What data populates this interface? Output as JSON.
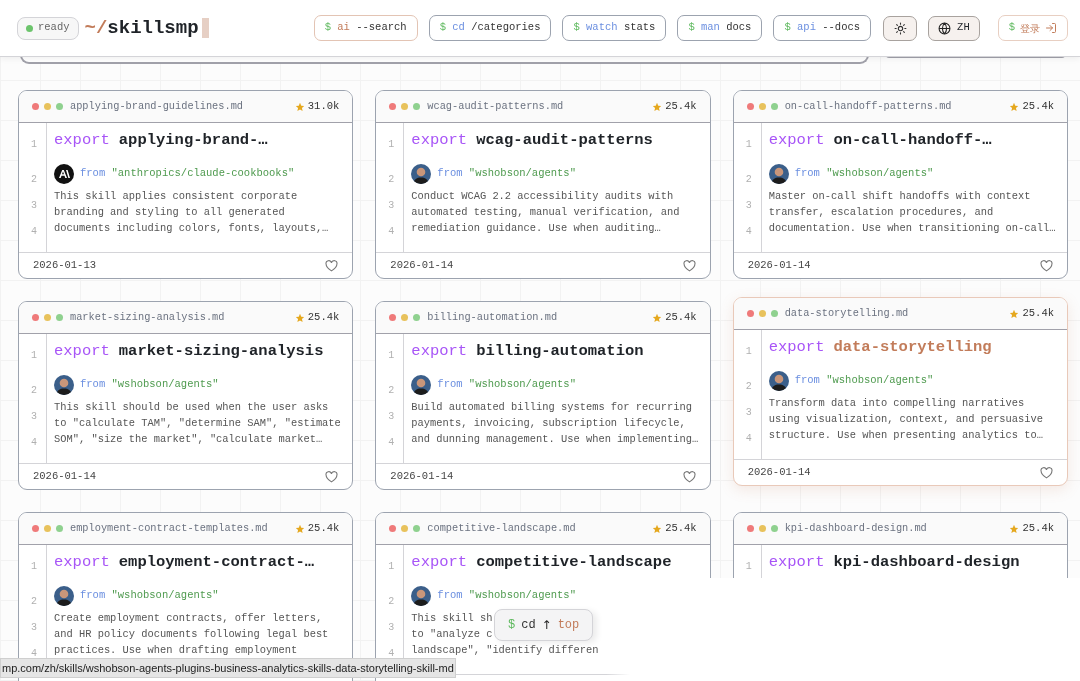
{
  "header": {
    "status": {
      "label": "ready",
      "online": true
    },
    "logo": {
      "prefix": "~/",
      "name": "skillsmp"
    },
    "nav": [
      {
        "prompt": "$",
        "command": "ai",
        "arg": "--search",
        "kind": "accent"
      },
      {
        "prompt": "$",
        "command": "cd",
        "arg": "/categories",
        "kind": "plain"
      },
      {
        "prompt": "$",
        "command": "watch",
        "arg": "stats",
        "kind": "plain"
      },
      {
        "prompt": "$",
        "command": "man",
        "arg": "docs",
        "kind": "plain"
      },
      {
        "prompt": "$",
        "command": "api",
        "arg": "--docs",
        "kind": "plain"
      }
    ],
    "language": "ZH",
    "login": {
      "prompt": "$",
      "label": "登录"
    }
  },
  "cards": [
    {
      "file": "applying-brand-guidelines.md",
      "stars": "31.0k",
      "keyword": "export",
      "title": "applying-brand-…",
      "from_keyword": "from",
      "source": "\"anthropics/claude-cookbooks\"",
      "avatar": {
        "kind": "logo"
      },
      "line_numbers": [
        "1",
        "2",
        "3",
        "4"
      ],
      "lines": [
        "This skill applies consistent corporate",
        "branding and styling to all generated",
        "documents including colors, fonts, layouts,…"
      ],
      "date": "2026-01-13",
      "hovered": false
    },
    {
      "file": "wcag-audit-patterns.md",
      "stars": "25.4k",
      "keyword": "export",
      "title": "wcag-audit-patterns",
      "from_keyword": "from",
      "source": "\"wshobson/agents\"",
      "avatar": {
        "kind": "person"
      },
      "line_numbers": [
        "1",
        "2",
        "3",
        "4"
      ],
      "lines": [
        "Conduct WCAG 2.2 accessibility audits with",
        "automated testing, manual verification, and",
        "remediation guidance. Use when auditing…"
      ],
      "date": "2026-01-14",
      "hovered": false
    },
    {
      "file": "on-call-handoff-patterns.md",
      "stars": "25.4k",
      "keyword": "export",
      "title": "on-call-handoff-…",
      "from_keyword": "from",
      "source": "\"wshobson/agents\"",
      "avatar": {
        "kind": "person"
      },
      "line_numbers": [
        "1",
        "2",
        "3",
        "4"
      ],
      "lines": [
        "Master on-call shift handoffs with context",
        "transfer, escalation procedures, and",
        "documentation. Use when transitioning on-call…"
      ],
      "date": "2026-01-14",
      "hovered": false
    },
    {
      "file": "market-sizing-analysis.md",
      "stars": "25.4k",
      "keyword": "export",
      "title": "market-sizing-analysis",
      "from_keyword": "from",
      "source": "\"wshobson/agents\"",
      "avatar": {
        "kind": "person"
      },
      "line_numbers": [
        "1",
        "2",
        "3",
        "4"
      ],
      "lines": [
        "This skill should be used when the user asks",
        "to \"calculate TAM\", \"determine SAM\", \"estimate",
        "SOM\", \"size the market\", \"calculate market…"
      ],
      "date": "2026-01-14",
      "hovered": false
    },
    {
      "file": "billing-automation.md",
      "stars": "25.4k",
      "keyword": "export",
      "title": "billing-automation",
      "from_keyword": "from",
      "source": "\"wshobson/agents\"",
      "avatar": {
        "kind": "person"
      },
      "line_numbers": [
        "1",
        "2",
        "3",
        "4"
      ],
      "lines": [
        "Build automated billing systems for recurring",
        "payments, invoicing, subscription lifecycle,",
        "and dunning management. Use when implementing…"
      ],
      "date": "2026-01-14",
      "hovered": false
    },
    {
      "file": "data-storytelling.md",
      "stars": "25.4k",
      "keyword": "export",
      "title": "data-storytelling",
      "from_keyword": "from",
      "source": "\"wshobson/agents\"",
      "avatar": {
        "kind": "person"
      },
      "line_numbers": [
        "1",
        "2",
        "3",
        "4"
      ],
      "lines": [
        "Transform data into compelling narratives",
        "using visualization, context, and persuasive",
        "structure. Use when presenting analytics to…"
      ],
      "date": "2026-01-14",
      "hovered": true
    },
    {
      "file": "employment-contract-templates.md",
      "stars": "25.4k",
      "keyword": "export",
      "title": "employment-contract-…",
      "from_keyword": "from",
      "source": "\"wshobson/agents\"",
      "avatar": {
        "kind": "person"
      },
      "line_numbers": [
        "1",
        "2",
        "3",
        "4"
      ],
      "lines": [
        "Create employment contracts, offer letters,",
        "and HR policy documents following legal best",
        "practices. Use when drafting employment"
      ],
      "hovered": false
    },
    {
      "file": "competitive-landscape.md",
      "stars": "25.4k",
      "keyword": "export",
      "title": "competitive-landscape",
      "from_keyword": "from",
      "source": "\"wshobson/agents\"",
      "avatar": {
        "kind": "person"
      },
      "line_numbers": [
        "1",
        "2",
        "3",
        "4"
      ],
      "lines": [
        "This skill sh",
        "to \"analyze c",
        "landscape\", \"identify differen"
      ],
      "hovered": false
    },
    {
      "file": "kpi-dashboard-design.md",
      "stars": "25.4k",
      "keyword": "export",
      "title": "kpi-dashboard-design",
      "line_numbers": [
        "1"
      ],
      "hovered": false
    }
  ],
  "scroll_top": {
    "prompt": "$",
    "command": "cd",
    "arrow": "↑",
    "label": "top"
  },
  "status_bar": {
    "url": "mp.com/zh/skills/wshobson-agents-plugins-business-analytics-skills-data-storytelling-skill-md"
  }
}
